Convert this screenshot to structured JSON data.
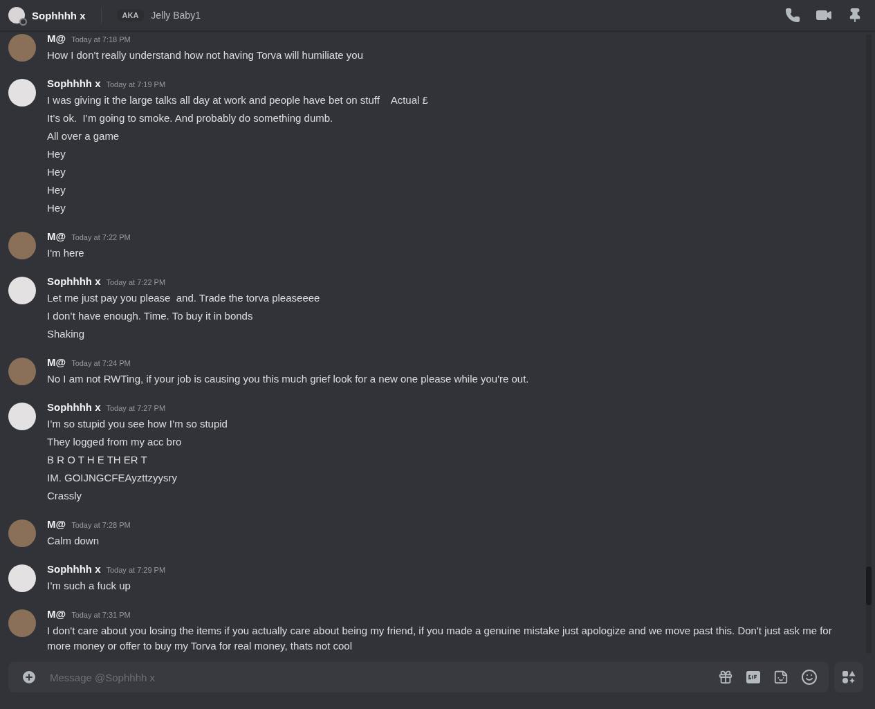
{
  "header": {
    "name": "Sophhhh x",
    "aka_badge": "AKA",
    "aka_name": "Jelly Baby1"
  },
  "messages": [
    {
      "author": "M@",
      "time": "Today at 7:18 PM",
      "lines": [
        "How I don't really understand how not having Torva will humiliate you"
      ]
    },
    {
      "author": "Sophhhh x",
      "time": "Today at 7:19 PM",
      "lines": [
        "I was giving it the large talks all day at work and people have bet on stuff    Actual £",
        "It’s ok.  I’m going to smoke. And probably do something dumb.",
        "All over a game",
        "Hey",
        "Hey",
        "Hey",
        "Hey"
      ]
    },
    {
      "author": "M@",
      "time": "Today at 7:22 PM",
      "lines": [
        "I'm here"
      ]
    },
    {
      "author": "Sophhhh x",
      "time": "Today at 7:22 PM",
      "lines": [
        "Let me just pay you please  and. Trade the torva pleaseeee",
        "I don’t have enough. Time. To buy it in bonds",
        "Shaking"
      ]
    },
    {
      "author": "M@",
      "time": "Today at 7:24 PM",
      "lines": [
        "No I am not RWTing, if your job is causing you this much grief look for a new one please while you're out."
      ]
    },
    {
      "author": "Sophhhh x",
      "time": "Today at 7:27 PM",
      "lines": [
        "I’m so stupid you see how I’m so stupid",
        "They logged from my acc bro",
        "B R O T H E TH ER T",
        "IM. GOIJNGCFEAyzttzyysry",
        "Crassly"
      ]
    },
    {
      "author": "M@",
      "time": "Today at 7:28 PM",
      "lines": [
        "Calm down"
      ]
    },
    {
      "author": "Sophhhh x",
      "time": "Today at 7:29 PM",
      "lines": [
        "I’m such a fuck up"
      ]
    },
    {
      "author": "M@",
      "time": "Today at 7:31 PM",
      "lines": [
        "I don't care about you losing the items if you actually care about being my friend, if you made a genuine mistake just apologize and we move past this. Don't just ask me for more money or offer to buy my Torva for real money, thats not cool"
      ]
    }
  ],
  "composer": {
    "placeholder": "Message @Sophhhh x"
  }
}
